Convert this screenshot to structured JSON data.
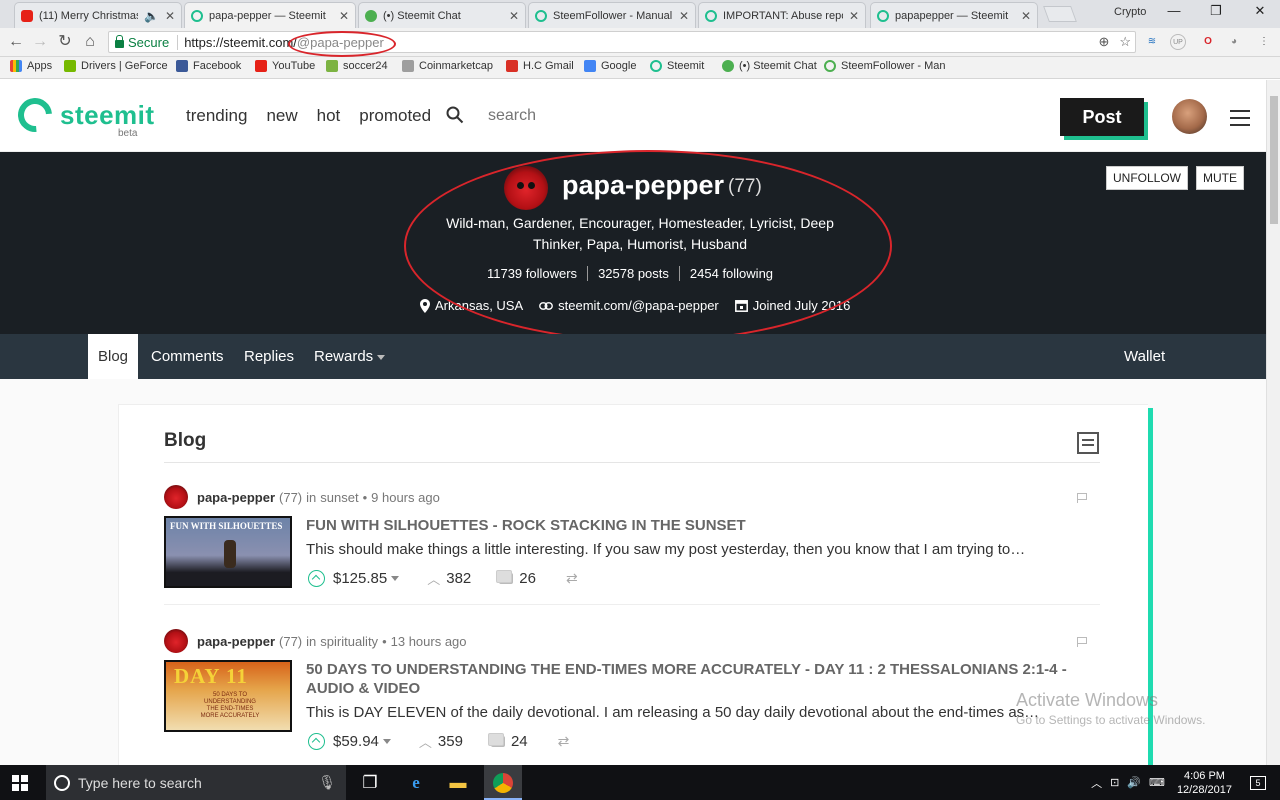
{
  "browser": {
    "tabs": [
      {
        "title": "(11) Merry Christmas",
        "icon": "youtube-icon",
        "color": "#e62117",
        "active": false
      },
      {
        "title": "papa-pepper — Steemit",
        "icon": "steemit-icon",
        "color": "#1fbf8f",
        "active": true
      },
      {
        "title": "(•) Steemit Chat",
        "icon": "chat-icon",
        "color": "#4caf50",
        "active": false
      },
      {
        "title": "SteemFollower - Manual",
        "icon": "steemfollower-icon",
        "color": "#1fbf8f",
        "active": false
      },
      {
        "title": "IMPORTANT: Abuse repo",
        "icon": "steemit-icon",
        "color": "#1fbf8f",
        "active": false
      },
      {
        "title": "papapepper — Steemit",
        "icon": "steemit-icon",
        "color": "#1fbf8f",
        "active": false
      }
    ],
    "profile_name": "Crypto",
    "address": {
      "secure_label": "Secure",
      "host": "https://steemit.com/",
      "path": "@papa-pepper"
    },
    "bookmarks": [
      {
        "label": "Apps",
        "icon": "apps-icon",
        "color": "#e94235"
      },
      {
        "label": "Drivers | GeForce",
        "icon": "geforce-icon",
        "color": "#76b900"
      },
      {
        "label": "Facebook",
        "icon": "facebook-icon",
        "color": "#3b5998"
      },
      {
        "label": "YouTube",
        "icon": "youtube-icon",
        "color": "#e62117"
      },
      {
        "label": "soccer24",
        "icon": "soccer-icon",
        "color": "#7cb342"
      },
      {
        "label": "Coinmarketcap",
        "icon": "coin-icon",
        "color": "#9e9e9e"
      },
      {
        "label": "H.C Gmail",
        "icon": "gmail-icon",
        "color": "#d93025"
      },
      {
        "label": "Google",
        "icon": "google-icon",
        "color": "#4285f4"
      },
      {
        "label": "Steemit",
        "icon": "steemit-icon",
        "color": "#1fbf8f"
      },
      {
        "label": "(•) Steemit Chat",
        "icon": "chat-icon",
        "color": "#4caf50"
      },
      {
        "label": "SteemFollower - Man",
        "icon": "steemfollower-icon",
        "color": "#4caf50"
      }
    ]
  },
  "site": {
    "logo": "steemit",
    "beta": "beta",
    "nav": [
      "trending",
      "new",
      "hot",
      "promoted"
    ],
    "search_placeholder": "search",
    "post_button": "Post",
    "brand_color": "#1fbf8f"
  },
  "profile": {
    "name": "papa-pepper",
    "reputation": "(77)",
    "about": "Wild-man, Gardener, Encourager, Homesteader, Lyricist, Deep Thinker, Papa, Humorist, Husband",
    "followers": "11739 followers",
    "posts": "32578 posts",
    "following": "2454 following",
    "location": "Arkansas, USA",
    "website": "steemit.com/@papa-pepper",
    "joined": "Joined July 2016",
    "unfollow_label": "UNFOLLOW",
    "mute_label": "MUTE"
  },
  "profile_tabs": {
    "blog": "Blog",
    "comments": "Comments",
    "replies": "Replies",
    "rewards": "Rewards",
    "wallet": "Wallet"
  },
  "blog": {
    "heading": "Blog",
    "posts": [
      {
        "author": "papa-pepper",
        "rep": "(77)",
        "in_label": "in",
        "category": "sunset",
        "time": "9 hours ago",
        "thumb_text": "FUN WITH SILHOUETTES",
        "title": "FUN WITH SILHOUETTES - ROCK STACKING IN THE SUNSET",
        "excerpt": "This should make things a little interesting. If you saw my post yesterday, then you know that I am trying to…",
        "payout": "$125.85",
        "votes": "382",
        "comments": "26"
      },
      {
        "author": "papa-pepper",
        "rep": "(77)",
        "in_label": "in",
        "category": "spirituality",
        "time": "13 hours ago",
        "thumb_text": "DAY 11",
        "thumb_sub": "50 DAYS TO UNDERSTANDING THE END-TIMES MORE ACCURATELY",
        "title": "50 DAYS TO UNDERSTANDING THE END-TIMES MORE ACCURATELY - DAY 11 : 2 THESSALONIANS 2:1-4 - AUDIO & VIDEO",
        "excerpt": "This is DAY ELEVEN of the daily devotional. I am releasing a 50 day daily devotional about the end-times as…",
        "payout": "$59.94",
        "votes": "359",
        "comments": "24"
      }
    ]
  },
  "watermark": {
    "line1": "Activate Windows",
    "line2": "Go to Settings to activate Windows."
  },
  "taskbar": {
    "search_placeholder": "Type here to search",
    "time": "4:06 PM",
    "date": "12/28/2017",
    "notification_count": "5"
  }
}
